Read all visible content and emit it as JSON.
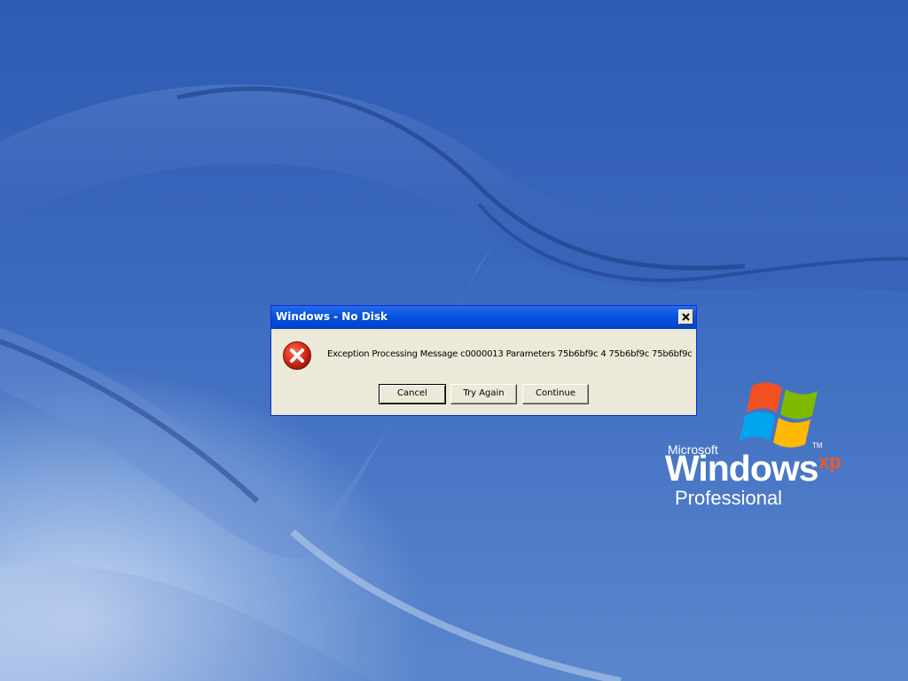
{
  "desktop": {
    "logo": {
      "microsoft": "Microsoft",
      "windows": "Windows",
      "xp": "xp",
      "tm": "TM",
      "edition": "Professional"
    }
  },
  "dialog": {
    "title": "Windows - No Disk",
    "close_icon": "close-icon",
    "icon": "error-icon",
    "message": "Exception Processing Message c0000013 Parameters 75b6bf9c 4 75b6bf9c 75b6bf9c",
    "buttons": {
      "cancel": "Cancel",
      "try_again": "Try Again",
      "continue": "Continue"
    }
  },
  "colors": {
    "title_bar": "#0553e0",
    "dialog_face": "#ece9d8",
    "error_red": "#d32a16",
    "xp_orange": "#f05a23"
  }
}
